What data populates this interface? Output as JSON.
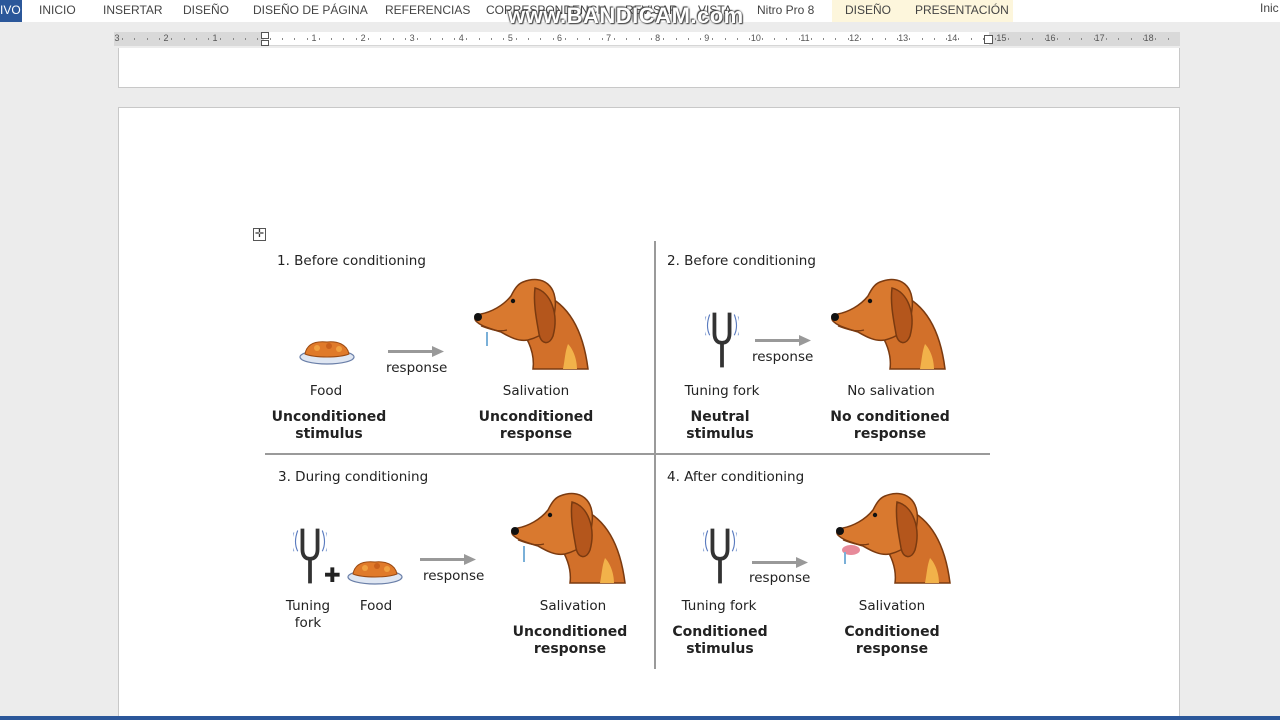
{
  "ribbon": {
    "file_tab": "IVO",
    "tabs": [
      "INICIO",
      "INSERTAR",
      "DISEÑO",
      "DISEÑO DE PÁGINA",
      "REFERENCIAS",
      "CORRESPONDENCIA",
      "REVISAR",
      "VISTA",
      "Nitro Pro 8"
    ],
    "context_tabs": [
      "DISEÑO",
      "PRESENTACIÓN"
    ],
    "user_initial": "Inic"
  },
  "watermark": "www.BANDICAM.com",
  "ruler": {
    "left_numbers": [
      "3",
      "2",
      "1"
    ],
    "right_numbers": [
      "1",
      "2",
      "3",
      "4",
      "5",
      "6",
      "7",
      "8",
      "9",
      "10",
      "11",
      "12",
      "13",
      "14",
      "15",
      "16",
      "17",
      "18"
    ]
  },
  "figure": {
    "panel1": {
      "title": "1. Before conditioning",
      "arrow_label": "response",
      "left_caption": "Food",
      "left_bold": [
        "Unconditioned",
        "stimulus"
      ],
      "right_caption": "Salivation",
      "right_bold": [
        "Unconditioned",
        "response"
      ]
    },
    "panel2": {
      "title": "2. Before conditioning",
      "arrow_label": "response",
      "left_caption": "Tuning fork",
      "left_bold": [
        "Neutral",
        "stimulus"
      ],
      "right_caption": "No salivation",
      "right_bold": [
        "No conditioned",
        "response"
      ]
    },
    "panel3": {
      "title": "3. During conditioning",
      "arrow_label": "response",
      "left_caption_1": [
        "Tuning",
        "fork"
      ],
      "left_caption_2": "Food",
      "right_caption": "Salivation",
      "right_bold": [
        "Unconditioned",
        "response"
      ]
    },
    "panel4": {
      "title": "4. After conditioning",
      "arrow_label": "response",
      "left_caption": "Tuning fork",
      "left_bold": [
        "Conditioned",
        "stimulus"
      ],
      "right_caption": "Salivation",
      "right_bold": [
        "Conditioned",
        "response"
      ]
    }
  },
  "colors": {
    "ribbon_blue": "#2b579a",
    "context_tab_bg": "#fdf6dc",
    "dog_fur": "#d2702a",
    "dog_dark": "#7a3a10",
    "food": "#e07a2a"
  }
}
